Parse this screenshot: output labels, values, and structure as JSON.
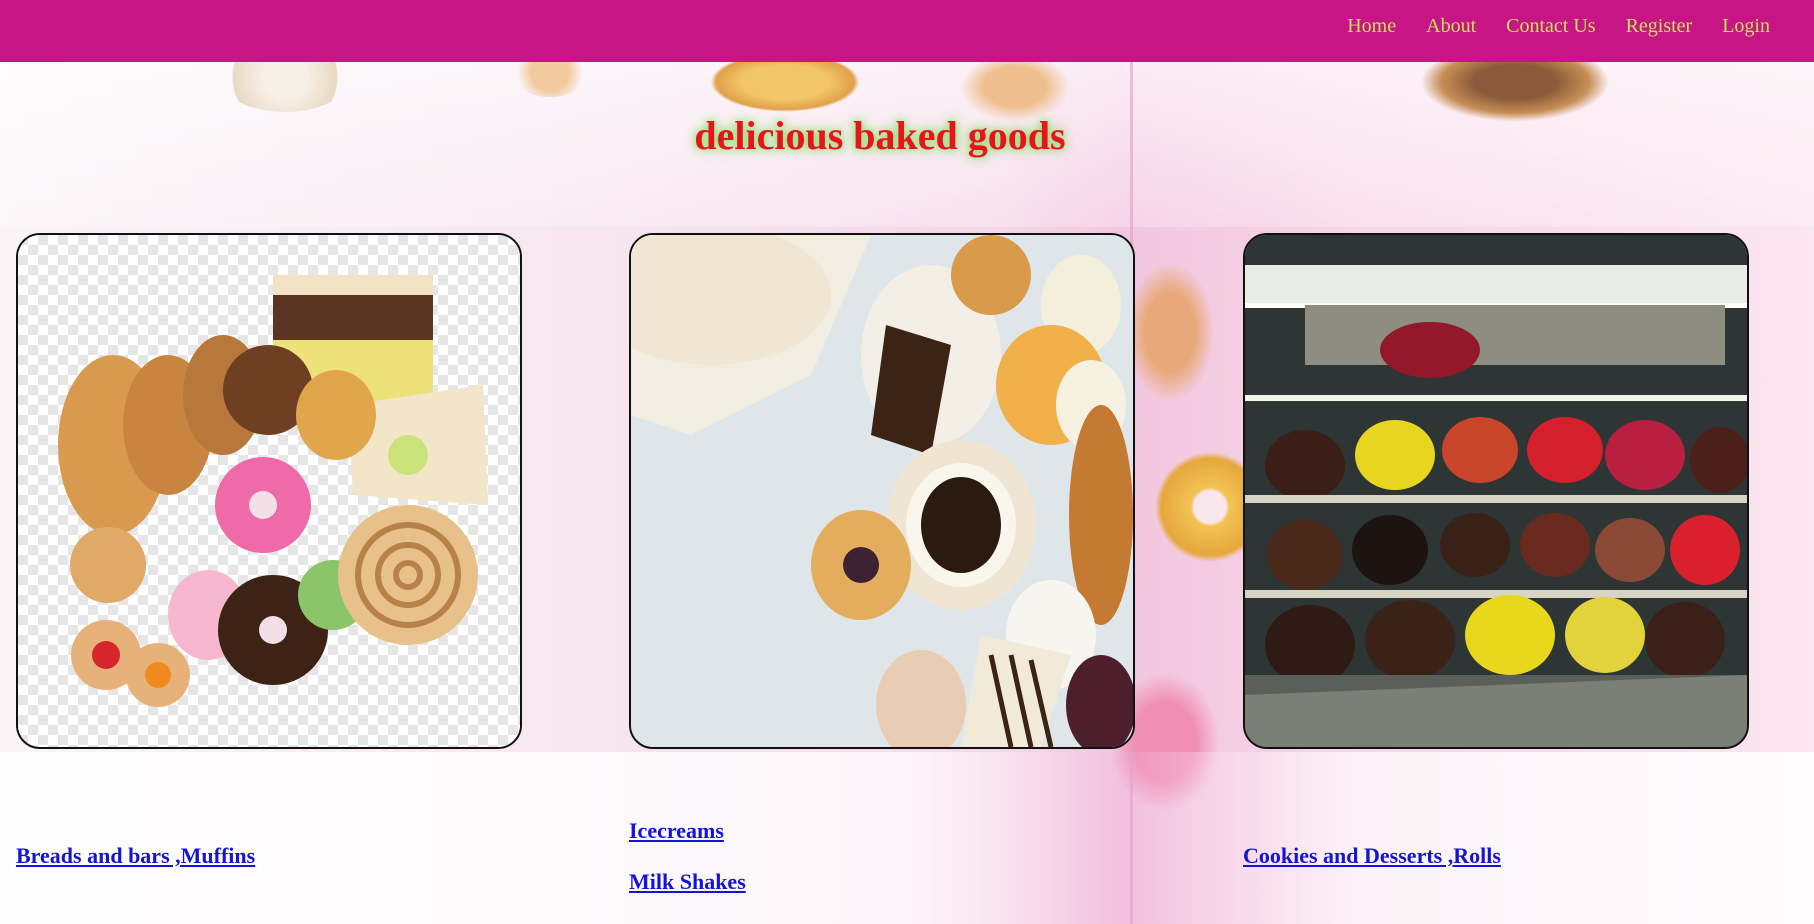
{
  "nav": {
    "items": [
      "Home",
      "About",
      "Contact Us",
      "Register",
      "Login"
    ]
  },
  "hero": {
    "title": "delicious baked goods"
  },
  "cards": [
    {
      "image": "assorted-pastries-photo",
      "links": [
        "Breads and bars ,Muffins"
      ]
    },
    {
      "image": "coffee-and-pastries-photo",
      "links": [
        "Icecreams",
        "Milk Shakes"
      ]
    },
    {
      "image": "cake-display-case-photo",
      "links": [
        "Cookies and Desserts ,Rolls"
      ]
    }
  ],
  "colors": {
    "navbar": "#c71585",
    "nav_text": "#c7e05a",
    "title": "#e8141b",
    "link": "#1414d6"
  }
}
